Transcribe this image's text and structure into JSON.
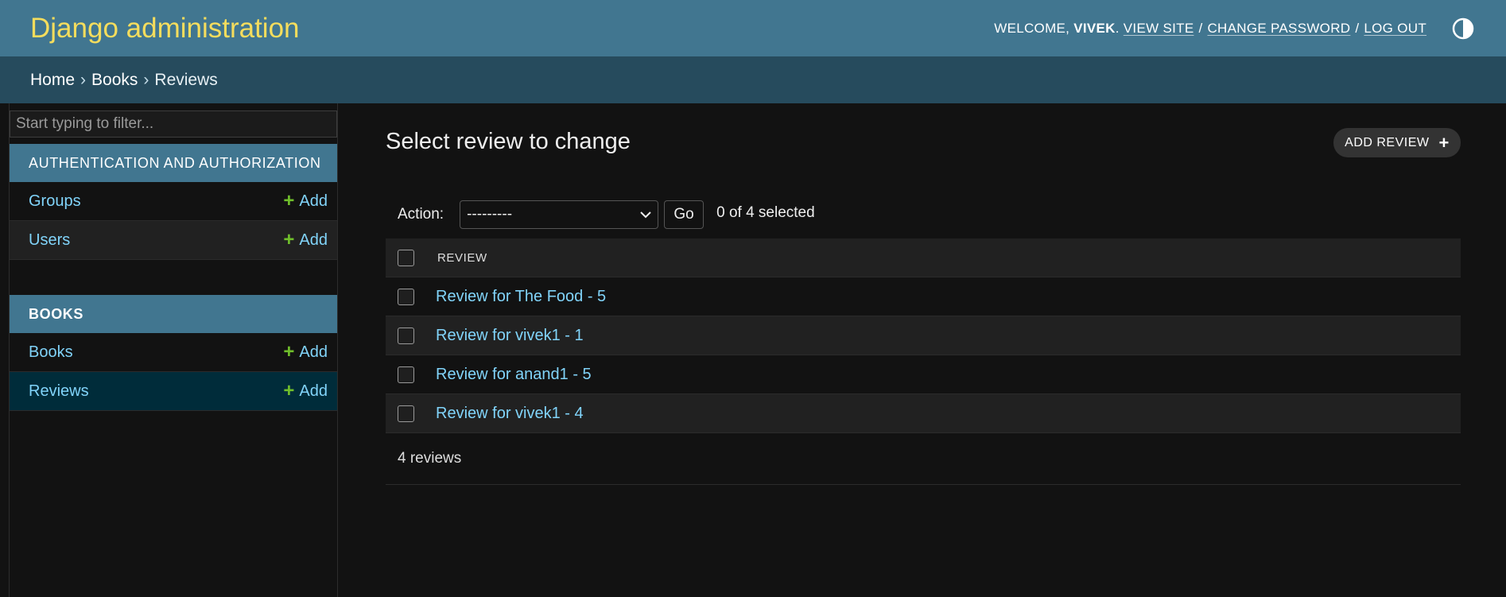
{
  "header": {
    "branding": "Django administration",
    "welcome": "Welcome,",
    "username": "vivek",
    "links": {
      "view_site": "View site",
      "change_password": "Change password",
      "log_out": "Log out"
    },
    "separator": "/",
    "theme_icon": "contrast-half-circle-icon"
  },
  "breadcrumbs": {
    "items": [
      "Home",
      "Books",
      "Reviews"
    ],
    "separator": "›"
  },
  "sidebar": {
    "filter_placeholder": "Start typing to filter...",
    "modules": [
      {
        "caption": "Authentication and Authorization",
        "rows": [
          {
            "label": "Groups",
            "add": "Add"
          },
          {
            "label": "Users",
            "add": "Add"
          }
        ]
      },
      {
        "caption": "Books",
        "rows": [
          {
            "label": "Books",
            "add": "Add"
          },
          {
            "label": "Reviews",
            "add": "Add"
          }
        ]
      }
    ]
  },
  "content": {
    "title": "Select review to change",
    "add_button": "Add Review",
    "actions": {
      "label": "Action:",
      "select_value": "---------",
      "go": "Go",
      "selected": "0 of 4 selected"
    },
    "table": {
      "column": "Review",
      "rows": [
        "Review for The Food - 5",
        "Review for vivek1 - 1",
        "Review for anand1 - 5",
        "Review for vivek1 - 4"
      ]
    },
    "paginator": "4 reviews"
  },
  "colors": {
    "header": "#417690",
    "branding": "#f5dd5d",
    "breadcrumbs": "#264b5d",
    "link": "#81d4fa",
    "add_plus": "#70bf2b",
    "background": "#121212"
  }
}
